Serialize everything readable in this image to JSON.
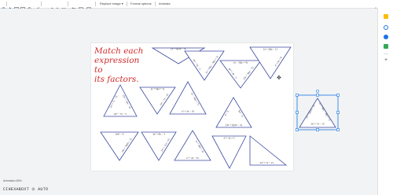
{
  "toolbar": {
    "replace_image": "Replace image ▾",
    "format_options": "Format options",
    "animate": "Animate"
  },
  "slide": {
    "title_line1": "Match each",
    "title_line2": "expression to",
    "title_line3": "its factors."
  },
  "expressions": [
    "2x² + 7x − 15",
    "(x + 5)(2x − 3)",
    "(x + 5)(x − 3)(x + 1)",
    "3x² − 5x − 2",
    "(x − 5)(x + 4)",
    "(2x + 3)(x − 5)",
    "4x² + 4x − 3",
    "(x + 2)(x − 1)",
    "x² + 6x + 8",
    "(3x + 1)(x − 2)",
    "6x² − 7x − 3",
    "(x + 5)(x + 1)",
    "2x² − 7x − 15",
    "(x − 3)(x + 7)",
    "x² + 3x − 10",
    "9x² − 4",
    "(3x + 2)(3x − 2)",
    "x² − 9",
    "16x² − 9",
    "(4x + 3)(4x − 3)",
    "3x² + 8x − 3",
    "2x² + 11x + 15",
    "(x + 4)(x + 2)",
    "x² + 2x − 35",
    "x² + 3x + 2"
  ],
  "footer": {
    "caption": "Animation 48%",
    "code": "CIHEXABDXT ⊙ AUTO"
  },
  "colors": {
    "triangle_stroke": "#3b4aa0",
    "title_red": "#d32b2b",
    "selection_blue": "#1a73e8"
  }
}
